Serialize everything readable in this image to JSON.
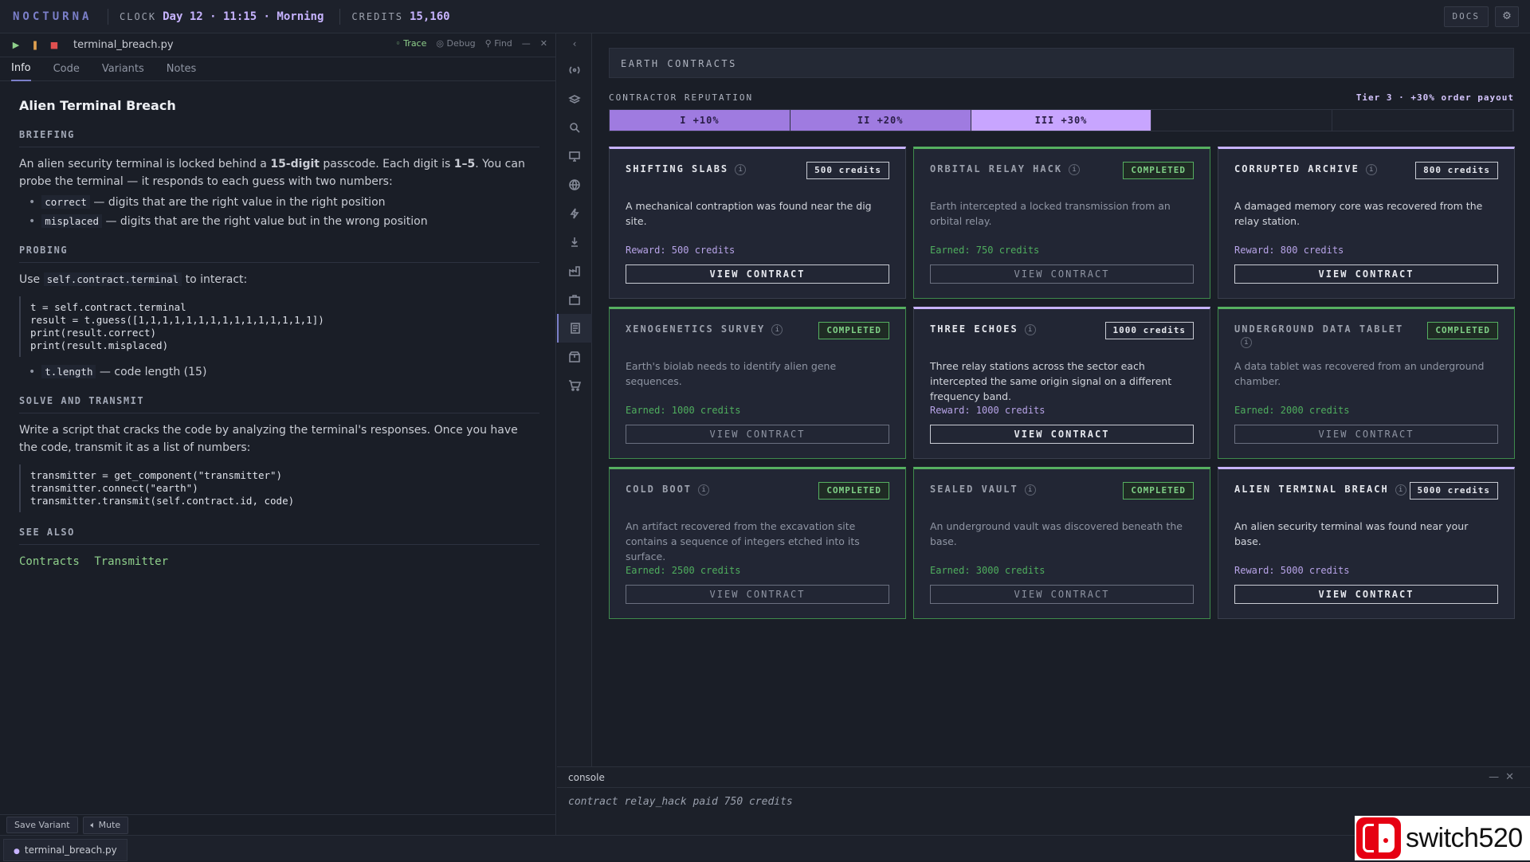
{
  "topbar": {
    "brand": "NOCTURNA",
    "clock_label": "CLOCK",
    "clock_value": "Day 12 · 11:15 · Morning",
    "credits_label": "CREDITS",
    "credits_value": "15,160",
    "docs_label": "DOCS",
    "settings_icon": "gear-icon"
  },
  "editor": {
    "file_name": "terminal_breach.py",
    "toolbar": {
      "trace_label": "Trace",
      "debug_label": "Debug",
      "find_label": "Find",
      "run_icon": "play-icon",
      "pause_icon": "pause-icon",
      "stop_icon": "stop-icon"
    },
    "tabs": [
      "Info",
      "Code",
      "Variants",
      "Notes"
    ],
    "active_tab": "Info",
    "doc": {
      "title": "Alien Terminal Breach",
      "briefing_heading": "BRIEFING",
      "briefing_p1_a": "An alien security terminal is locked behind a ",
      "briefing_p1_b": "15-digit",
      "briefing_p1_c": " passcode. Each digit is ",
      "briefing_p1_d": "1–5",
      "briefing_p1_e": ". You can probe the terminal — it responds to each guess with two numbers:",
      "bullets": [
        {
          "code": "correct",
          "text": " — digits that are the right value in the right position"
        },
        {
          "code": "misplaced",
          "text": " — digits that are the right value but in the wrong position"
        }
      ],
      "probing_heading": "PROBING",
      "probing_use": "Use ",
      "probing_code": "self.contract.terminal",
      "probing_tail": " to interact:",
      "probing_block": "t = self.contract.terminal\nresult = t.guess([1,1,1,1,1,1,1,1,1,1,1,1,1,1,1])\nprint(result.correct)\nprint(result.misplaced)",
      "length_code": "t.length",
      "length_text": " — code length (15)",
      "solve_heading": "SOLVE AND TRANSMIT",
      "solve_text": "Write a script that cracks the code by analyzing the terminal's responses. Once you have the code, transmit it as a list of numbers:",
      "solve_block": "transmitter = get_component(\"transmitter\")\ntransmitter.connect(\"earth\")\ntransmitter.transmit(self.contract.id, code)",
      "see_also_heading": "SEE ALSO",
      "see_also_links": [
        "Contracts",
        "Transmitter"
      ]
    },
    "bottom": {
      "save_variant": "Save Variant",
      "mute": "Mute"
    }
  },
  "file_tab": {
    "name": "terminal_breach.py"
  },
  "sidebar_icons": [
    "broadcast-icon",
    "layers-icon",
    "search-icon",
    "monitor-icon",
    "globe-icon",
    "lightning-icon",
    "download-icon",
    "factory-icon",
    "briefcase-icon",
    "document-icon",
    "package-icon",
    "cart-icon"
  ],
  "main": {
    "header": "EARTH CONTRACTS",
    "reputation": {
      "label": "CONTRACTOR REPUTATION",
      "tier_text": "Tier 3 · +30% order payout",
      "segments": [
        "I +10%",
        "II +20%",
        "III +30%",
        "",
        ""
      ],
      "current_tier": 3
    },
    "cards": [
      {
        "title": "SHIFTING SLABS",
        "badge": "500 credits",
        "desc": "A mechanical contraption was found near the dig site.",
        "reward": "Reward: 500 credits",
        "button": "VIEW CONTRACT",
        "done": false
      },
      {
        "title": "ORBITAL RELAY HACK",
        "badge": "COMPLETED",
        "desc": "Earth intercepted a locked transmission from an orbital relay.",
        "reward": "Earned: 750 credits",
        "button": "VIEW CONTRACT",
        "done": true
      },
      {
        "title": "CORRUPTED ARCHIVE",
        "badge": "800 credits",
        "desc": "A damaged memory core was recovered from the relay station.",
        "reward": "Reward: 800 credits",
        "button": "VIEW CONTRACT",
        "done": false
      },
      {
        "title": "XENOGENETICS SURVEY",
        "badge": "COMPLETED",
        "desc": "Earth's biolab needs to identify alien gene sequences.",
        "reward": "Earned: 1000 credits",
        "button": "VIEW CONTRACT",
        "done": true
      },
      {
        "title": "THREE ECHOES",
        "badge": "1000 credits",
        "desc": "Three relay stations across the sector each intercepted the same origin signal on a different frequency band.",
        "reward": "Reward: 1000 credits",
        "button": "VIEW CONTRACT",
        "done": false
      },
      {
        "title": "UNDERGROUND DATA TABLET",
        "badge": "COMPLETED",
        "desc": "A data tablet was recovered from an underground chamber.",
        "reward": "Earned: 2000 credits",
        "button": "VIEW CONTRACT",
        "done": true
      },
      {
        "title": "COLD BOOT",
        "badge": "COMPLETED",
        "desc": "An artifact recovered from the excavation site contains a sequence of integers etched into its surface.",
        "reward": "Earned: 2500 credits",
        "button": "VIEW CONTRACT",
        "done": true
      },
      {
        "title": "SEALED VAULT",
        "badge": "COMPLETED",
        "desc": "An underground vault was discovered beneath the base.",
        "reward": "Earned: 3000 credits",
        "button": "VIEW CONTRACT",
        "done": true
      },
      {
        "title": "ALIEN TERMINAL BREACH",
        "badge": "5000 credits",
        "desc": "An alien security terminal was found near your base.",
        "reward": "Reward: 5000 credits",
        "button": "VIEW CONTRACT",
        "done": false
      }
    ]
  },
  "console": {
    "title": "console",
    "lines": [
      "contract relay_hack paid 750 credits"
    ]
  },
  "watermark": {
    "text": "switch520"
  }
}
